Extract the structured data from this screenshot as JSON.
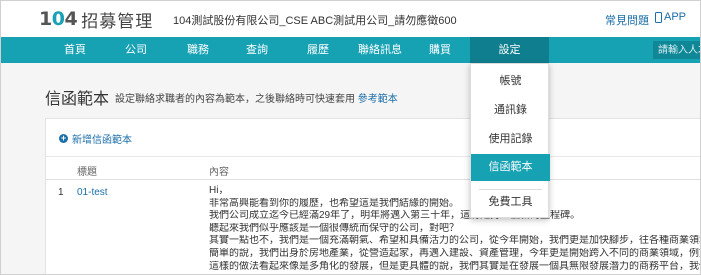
{
  "header": {
    "logo_num": "104",
    "logo_title": "招募管理",
    "company": "104測試股份有限公司_CSE ABC測試用公司_請勿應徵600",
    "help": "常見問題",
    "app": "APP"
  },
  "nav": {
    "items": [
      "首頁",
      "公司",
      "職務",
      "查詢",
      "履歷",
      "聯絡訊息",
      "購買",
      "設定"
    ],
    "active": "設定",
    "search_placeholder": "請輸入人才"
  },
  "page": {
    "title": "信函範本",
    "desc": "設定聯絡求職者的內容為範本，之後聯絡時可快速套用",
    "ref_link": "參考範本"
  },
  "card": {
    "add_label": "新增信函範本",
    "columns": [
      "標題",
      "內容"
    ],
    "rows": [
      {
        "num": "1",
        "title": "01-test",
        "content": [
          "Hi，",
          "非常高興能看到你的履歷，也希望這是我們結緣的開始。",
          "我們公司成立迄今已經滿29年了，明年將邁入第三十年，這將是另一個新的里程碑。",
          "聽起來我們似乎應該是一個很傳統而保守的公司，對吧？",
          "其實一點也不，我們是一個充滿朝氣、希望和具備活力的公司，從今年開始，我們更是加快腳步，往各種商業領域大...",
          "簡單的說，我們出身於房地產業，從營造起家，再邁入建設、資產管理，今年更是開始跨入不同的商業領域，例如：...",
          "這樣的做法看起來像是多角化的發展，但是更具體的說，我們其實是在發展一個具無限發展潛力的商務平台，我們希..."
        ]
      }
    ]
  },
  "dropdown": {
    "items": [
      "帳號",
      "通訊錄",
      "使用記錄",
      "信函範本",
      "免費工具"
    ],
    "active": "信函範本"
  },
  "colors": {
    "accent": "#17a2b4",
    "nav_active": "#0f7f8f",
    "link": "#1b6ea8"
  }
}
